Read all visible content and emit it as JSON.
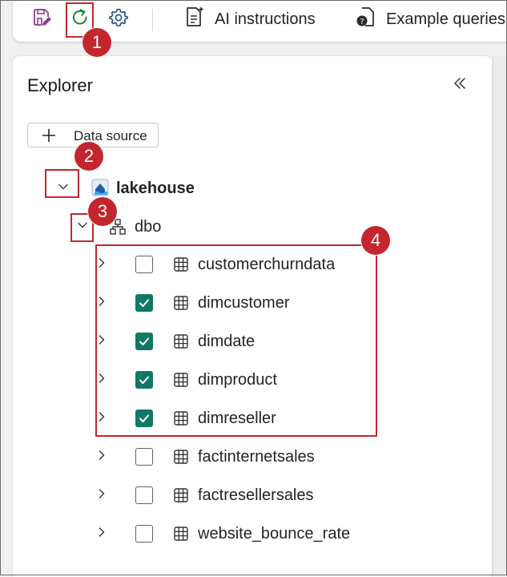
{
  "toolbar": {
    "ai_instructions_label": "AI instructions",
    "example_queries_label": "Example queries",
    "save_icon": "save-edit-icon",
    "refresh_icon": "refresh-icon",
    "settings_icon": "gear-icon",
    "accent_color": "#117865"
  },
  "explorer": {
    "title": "Explorer",
    "data_source_label": "Data source",
    "lakehouse_label": "lakehouse",
    "schema_label": "dbo",
    "tables": [
      {
        "name": "customerchurndata",
        "checked": false
      },
      {
        "name": "dimcustomer",
        "checked": true
      },
      {
        "name": "dimdate",
        "checked": true
      },
      {
        "name": "dimproduct",
        "checked": true
      },
      {
        "name": "dimreseller",
        "checked": true
      },
      {
        "name": "factinternetsales",
        "checked": false
      },
      {
        "name": "factresellersales",
        "checked": false
      },
      {
        "name": "website_bounce_rate",
        "checked": false
      }
    ]
  },
  "annotations": {
    "badge_1": "1",
    "badge_2": "2",
    "badge_3": "3",
    "badge_4": "4",
    "color": "#c4262e"
  }
}
